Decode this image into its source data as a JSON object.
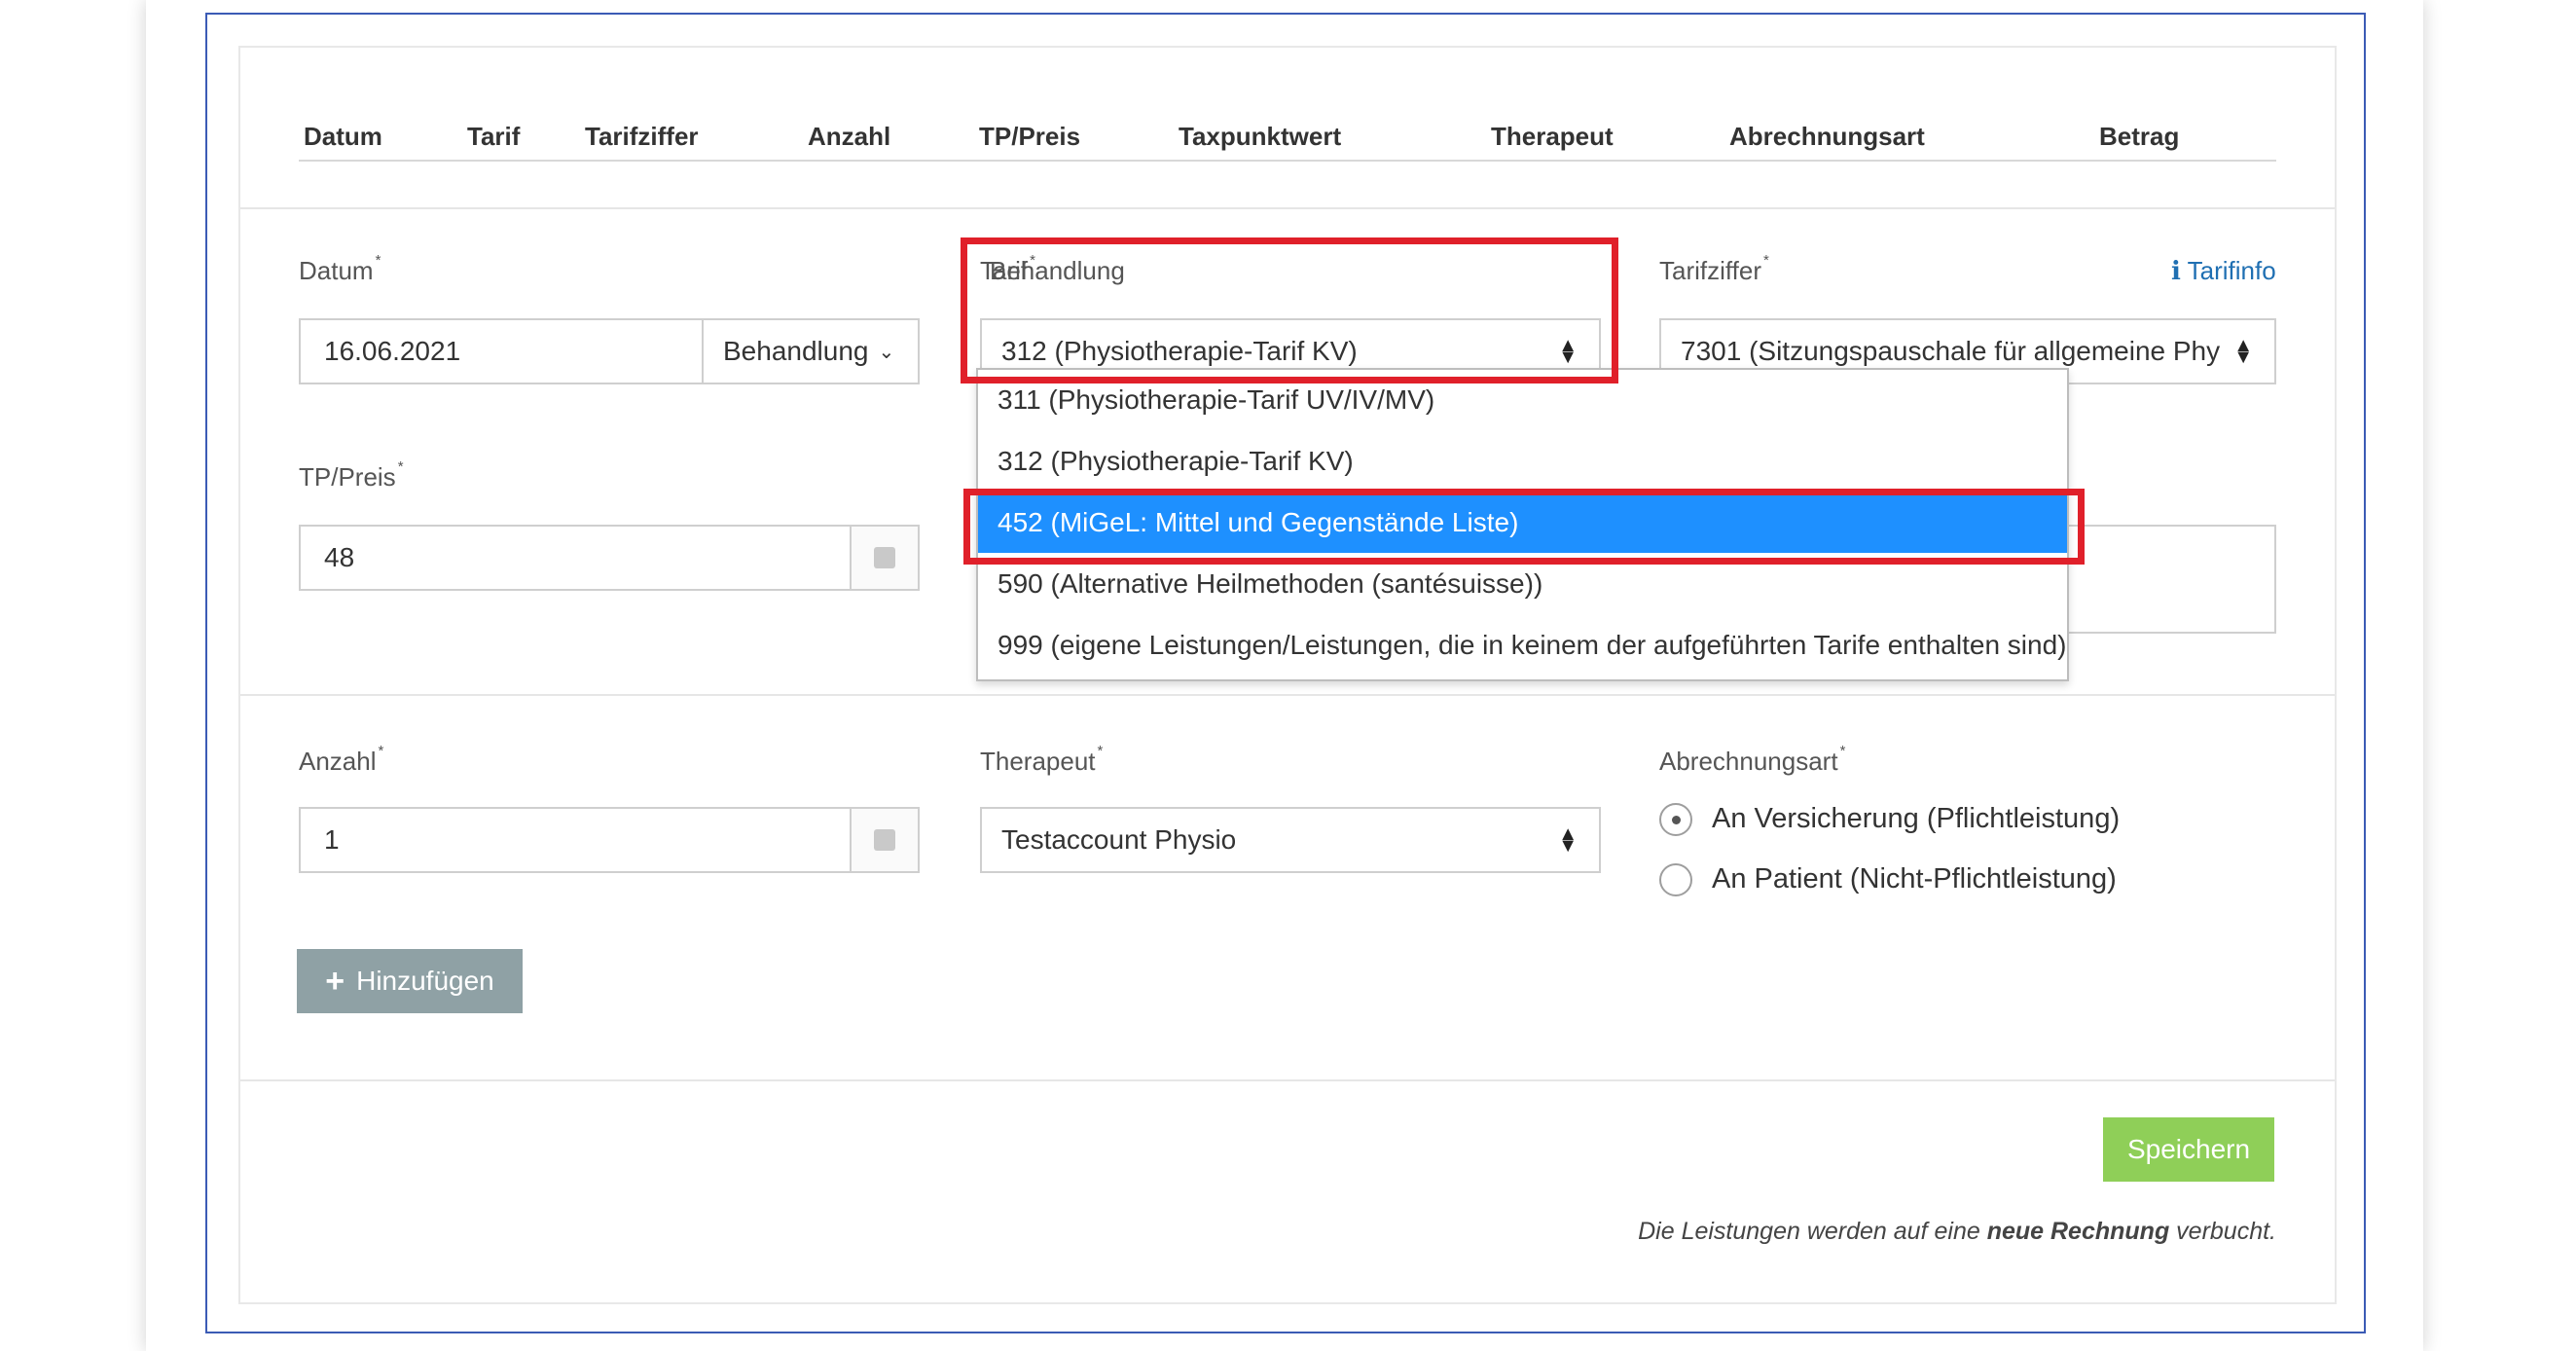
{
  "table_header": {
    "columns": [
      "Datum",
      "Tarif",
      "Tarifziffer",
      "Anzahl",
      "TP/Preis",
      "Taxpunktwert",
      "Therapeut",
      "Abrechnungsart",
      "Betrag"
    ]
  },
  "form": {
    "datum": {
      "label": "Datum",
      "required": "*",
      "value": "16.06.2021"
    },
    "behandlung": {
      "label": "Behandlung",
      "value": "Behandlung"
    },
    "tarif": {
      "label": "Tarif",
      "required": "*",
      "value": "312 (Physiotherapie-Tarif KV)"
    },
    "tarifziffer": {
      "label": "Tarifziffer",
      "required": "*",
      "value": "7301 (Sitzungspauschale für allgemeine Phy"
    },
    "tarifinfo": {
      "icon": "info-icon",
      "label": "Tarifinfo"
    },
    "tp_preis": {
      "label": "TP/Preis",
      "required": "*",
      "value": "48"
    },
    "partial_text": "e",
    "anzahl": {
      "label": "Anzahl",
      "required": "*",
      "value": "1"
    },
    "therapeut": {
      "label": "Therapeut",
      "required": "*",
      "value": "Testaccount Physio"
    },
    "abrechnungsart": {
      "label": "Abrechnungsart",
      "required": "*",
      "options": [
        "An Versicherung (Pflichtleistung)",
        "An Patient (Nicht-Pflichtleistung)"
      ],
      "selected_index": 0
    }
  },
  "tarif_dropdown": {
    "options": [
      "311 (Physiotherapie-Tarif UV/IV/MV)",
      "312 (Physiotherapie-Tarif KV)",
      "452 (MiGeL: Mittel und Gegenstände Liste)",
      "590 (Alternative Heilmethoden (santésuisse))",
      "999 (eigene Leistungen/Leistungen, die in keinem der aufgeführten Tarife enthalten sind)"
    ],
    "highlighted_index": 2
  },
  "buttons": {
    "add_label": "Hinzufügen",
    "add_icon": "+",
    "save_label": "Speichern"
  },
  "footer_note": {
    "prefix": "Die Leistungen werden auf eine ",
    "bold": "neue Rechnung",
    "suffix": " verbucht."
  },
  "colors": {
    "highlight": "#1e90ff",
    "annotation": "#e0202a",
    "save": "#8fcf58",
    "add": "#8fa1a5",
    "link": "#1f6fb2"
  }
}
